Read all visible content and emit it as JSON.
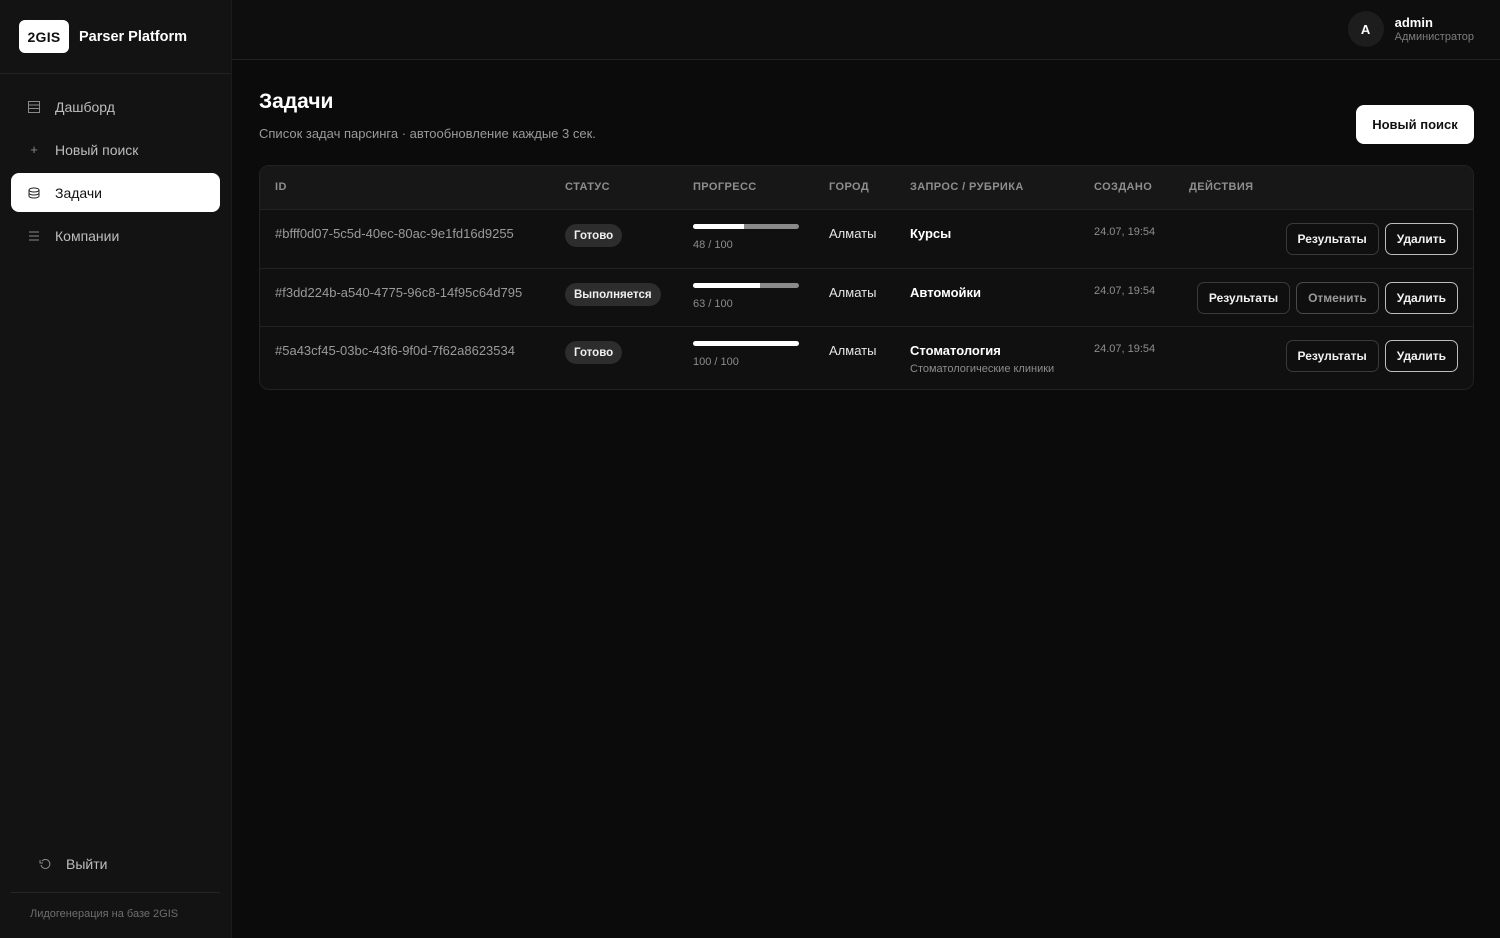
{
  "brand": {
    "logo": "2GIS",
    "name": "Parser Platform"
  },
  "nav": [
    {
      "label": "Дашборд",
      "icon": "dashboard-icon"
    },
    {
      "label": "Новый поиск",
      "icon": "plus-icon"
    },
    {
      "label": "Задачи",
      "icon": "tasks-icon",
      "active": true
    },
    {
      "label": "Компании",
      "icon": "list-icon"
    }
  ],
  "logout": {
    "label": "Выйти",
    "icon": "logout-icon"
  },
  "sidebar_footer": "Лидогенерация на базе 2GIS",
  "user": {
    "initial": "A",
    "name": "admin",
    "role": "Администратор"
  },
  "page": {
    "title": "Задачи",
    "subtitle": "Список задач парсинга · автообновление каждые 3 сек.",
    "new_search_label": "Новый поиск"
  },
  "table": {
    "columns": [
      "ID",
      "СТАТУС",
      "ПРОГРЕСС",
      "ГОРОД",
      "ЗАПРОС / РУБРИКА",
      "СОЗДАНО",
      "ДЕЙСТВИЯ"
    ],
    "rows": [
      {
        "id": "#bfff0d07-5c5d-40ec-80ac-9e1fd16d9255",
        "status": "Готово",
        "progress_done": 48,
        "progress_total": 100,
        "progress_text": "48 / 100",
        "city": "Алматы",
        "query": "Курсы",
        "rubric": "",
        "created": "24.07, 19:54",
        "actions": {
          "results": "Результаты",
          "delete": "Удалить"
        }
      },
      {
        "id": "#f3dd224b-a540-4775-96c8-14f95c64d795",
        "status": "Выполняется",
        "progress_done": 63,
        "progress_total": 100,
        "progress_text": "63 / 100",
        "city": "Алматы",
        "query": "Автомойки",
        "rubric": "",
        "created": "24.07, 19:54",
        "actions": {
          "results": "Результаты",
          "cancel": "Отменить",
          "delete": "Удалить"
        }
      },
      {
        "id": "#5a43cf45-03bc-43f6-9f0d-7f62a8623534",
        "status": "Готово",
        "progress_done": 100,
        "progress_total": 100,
        "progress_text": "100 / 100",
        "city": "Алматы",
        "query": "Стоматология",
        "rubric": "Стоматологические клиники",
        "created": "24.07, 19:54",
        "actions": {
          "results": "Результаты",
          "delete": "Удалить"
        }
      }
    ]
  }
}
